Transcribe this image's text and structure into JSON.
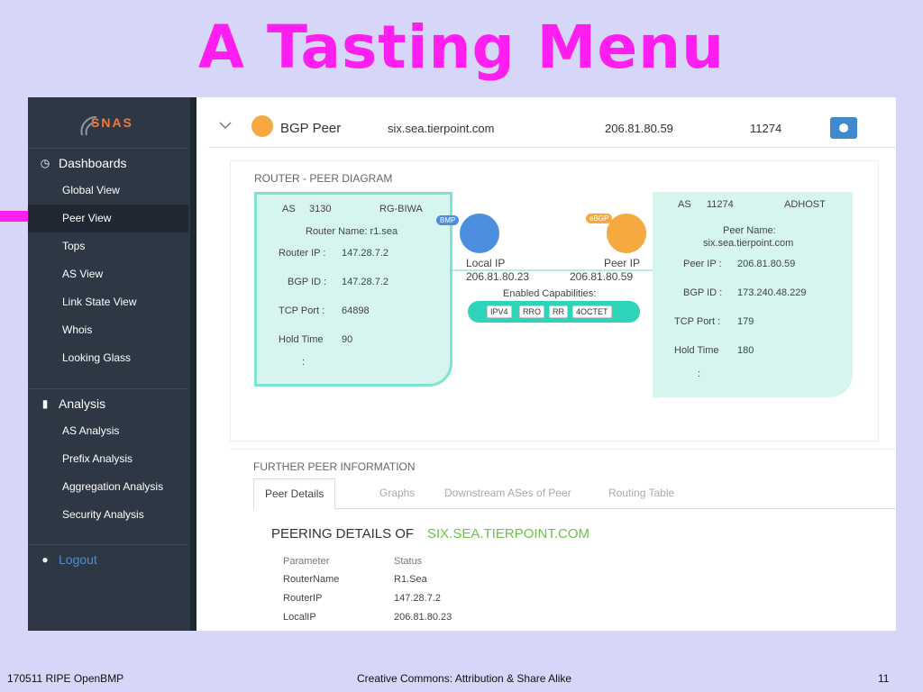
{
  "slide": {
    "title": "A Tasting Menu",
    "footer_left": "170511 RIPE OpenBMP",
    "footer_center": "Creative Commons: Attribution & Share Alike",
    "footer_right": "11",
    "arrow_color": "#ff1ef0"
  },
  "sidebar": {
    "logo": "SNAS",
    "dashboards_label": "Dashboards",
    "dashboard_items": [
      "Global View",
      "Peer View",
      "Tops",
      "AS View",
      "Link State View",
      "Whois",
      "Looking Glass"
    ],
    "analysis_label": "Analysis",
    "analysis_items": [
      "AS Analysis",
      "Prefix Analysis",
      "Aggregation Analysis",
      "Security Analysis"
    ],
    "logout_label": "Logout",
    "active_item": "Peer View"
  },
  "topbar": {
    "title": "BGP Peer",
    "host": "six.sea.tierpoint.com",
    "ip": "206.81.80.59",
    "as": "11274",
    "icons": [
      "chevron-down-icon",
      "bgp-peer-icon",
      "globe-icon"
    ]
  },
  "diagram": {
    "label": "ROUTER - PEER DIAGRAM",
    "router": {
      "as_label": "AS",
      "as": "3130",
      "org": "RG-BIWA",
      "name": "Router Name: r1.sea",
      "ip_label": "Router IP :",
      "ip": "147.28.7.2",
      "bgpid_label": "BGP ID :",
      "bgpid": "147.28.7.2",
      "tcp_label": "TCP Port :",
      "tcp": "64898",
      "hold_label": "Hold Time",
      "hold": "90",
      "more": ":"
    },
    "peer": {
      "as_label": "AS",
      "as": "11274",
      "org": "ADHOST",
      "name_label": "Peer Name:",
      "name": "six.sea.tierpoint.com",
      "ip_label": "Peer IP :",
      "ip": "206.81.80.59",
      "bgpid_label": "BGP ID :",
      "bgpid": "173.240.48.229",
      "tcp_label": "TCP Port :",
      "tcp": "179",
      "hold_label": "Hold Time",
      "hold": "180",
      "more": ":"
    },
    "bmp_tag": "BMP",
    "ebgp_tag": "eBGP",
    "local_ip_label": "Local IP",
    "local_ip": "206.81.80.23",
    "peer_ip_label": "Peer IP",
    "peer_ip": "206.81.80.59",
    "capabilities_label": "Enabled Capabilities:",
    "capabilities": [
      "IPV4",
      "RRO",
      "RR",
      "4OCTET"
    ]
  },
  "further": {
    "label": "FURTHER PEER INFORMATION",
    "tabs": [
      "Peer Details",
      "Graphs",
      "Downstream ASes of Peer",
      "Routing Table"
    ],
    "details_head": "PEERING DETAILS OF",
    "details_host": "SIX.SEA.TIERPOINT.COM",
    "col_param": "Parameter",
    "col_status": "Status",
    "rows": [
      {
        "param": "RouterName",
        "value": "R1.Sea"
      },
      {
        "param": "RouterIP",
        "value": "147.28.7.2"
      },
      {
        "param": "LocalIP",
        "value": "206.81.80.23"
      }
    ]
  }
}
